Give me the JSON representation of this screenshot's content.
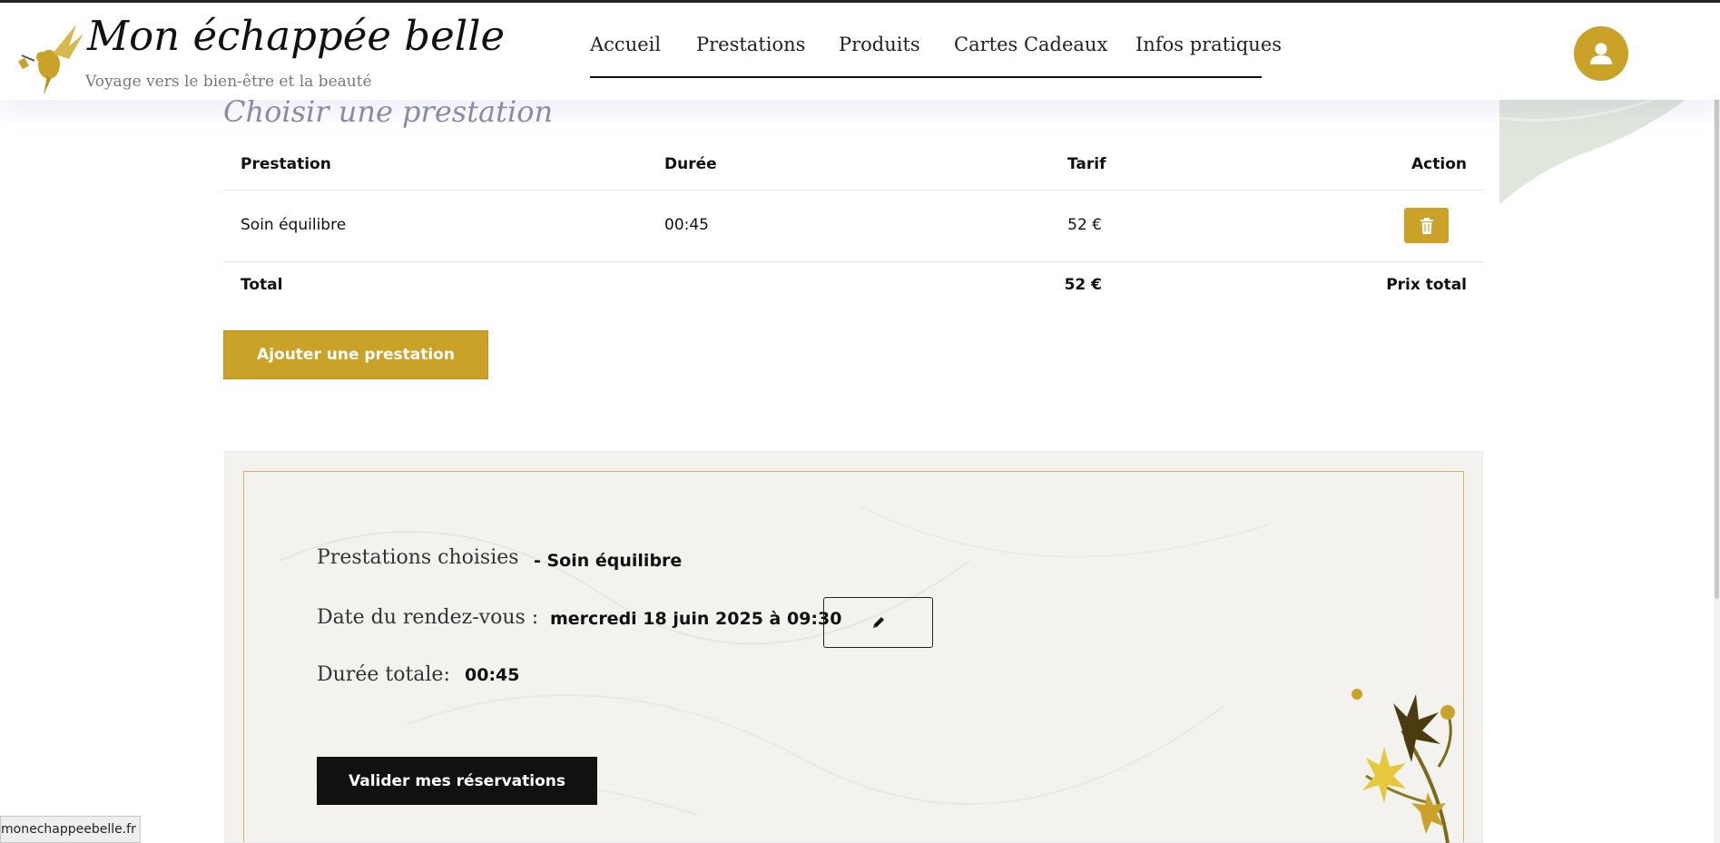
{
  "brand": {
    "title": "Mon échappée belle",
    "tagline": "Voyage vers le bien-être et la beauté"
  },
  "nav": {
    "items": [
      "Accueil",
      "Prestations",
      "Produits",
      "Cartes Cadeaux",
      "Infos pratiques"
    ]
  },
  "user_icon": "user-icon",
  "section_title": "Choisir une prestation",
  "table": {
    "headers": {
      "service": "Prestation",
      "duration": "Durée",
      "price": "Tarif",
      "action": "Action"
    },
    "rows": [
      {
        "service": "Soin équilibre",
        "duration": "00:45",
        "price": "52 €",
        "action_icon": "trash-icon"
      }
    ],
    "total": {
      "label": "Total",
      "price": "52 €",
      "action_label": "Prix total"
    }
  },
  "add_button_label": "Ajouter une prestation",
  "summary": {
    "chosen_label": "Prestations choisies",
    "chosen_value": "- Soin équilibre",
    "date_label": "Date du rendez-vous :",
    "date_value": "mercredi 18 juin 2025 à 09:30",
    "edit_icon": "pencil-icon",
    "duration_label": "Durée totale:",
    "duration_value": "00:45",
    "validate_label": "Valider mes réservations"
  },
  "status_url": "monechappeebelle.fr",
  "colors": {
    "accent": "#c9a227",
    "dark": "#111111",
    "title_muted": "#8a8aa8"
  }
}
